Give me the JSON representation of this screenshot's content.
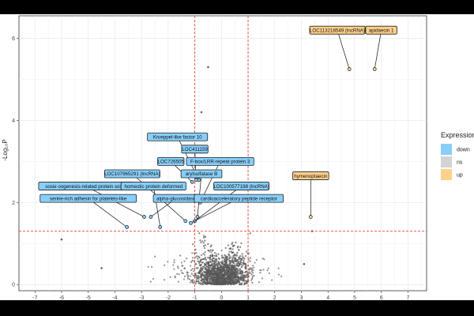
{
  "chart_data": {
    "type": "scatter",
    "title": "",
    "xlabel": "",
    "ylabel": "-Log₁₀P",
    "xlim": [
      -7.6,
      7.7
    ],
    "ylim": [
      -0.15,
      6.55
    ],
    "xticks": [
      -7,
      -6,
      -5,
      -4,
      -3,
      -2,
      -1,
      0,
      1,
      2,
      3,
      4,
      5,
      6,
      7
    ],
    "yticks": [
      0,
      2,
      4,
      6
    ],
    "grid": true,
    "thresholds": {
      "logfc": [
        -1,
        1
      ],
      "neglog10p": 1.3
    },
    "legend": {
      "title": "Expression",
      "placement": "right",
      "entries": [
        {
          "label": "down",
          "color": "#87CEFA"
        },
        {
          "label": "ns",
          "color": "#D3D3D3"
        },
        {
          "label": "up",
          "color": "#FFD08A"
        }
      ]
    },
    "labeled_points": [
      {
        "label": "LOC113218549 (lncRNA)",
        "x": 4.8,
        "y": 5.25,
        "group": "up",
        "lx": 4.35,
        "ly": 6.2
      },
      {
        "label": "apidaecin 1",
        "x": 5.75,
        "y": 5.25,
        "group": "up",
        "lx": 6.0,
        "ly": 6.2
      },
      {
        "label": "hymenoptaecin",
        "x": 3.35,
        "y": 1.65,
        "group": "up",
        "lx": 3.35,
        "ly": 2.65
      },
      {
        "label": "Krueppel-like factor 10",
        "x": -0.85,
        "y": 2.55,
        "group": "down",
        "lx": -1.65,
        "ly": 3.6
      },
      {
        "label": "LOC411159",
        "x": -0.95,
        "y": 2.55,
        "group": "down",
        "lx": -1.0,
        "ly": 3.3
      },
      {
        "label": "LOC726505",
        "x": -1.1,
        "y": 2.5,
        "group": "down",
        "lx": -1.9,
        "ly": 3.0
      },
      {
        "label": "F-box/LRR-repeat protein 3",
        "x": -0.8,
        "y": 2.0,
        "group": "down",
        "lx": -0.05,
        "ly": 3.0
      },
      {
        "label": "LOC107965291 (lncRNA)",
        "x": -1.35,
        "y": 1.55,
        "group": "down",
        "lx": -3.35,
        "ly": 2.7
      },
      {
        "label": "arylsulfatase B",
        "x": -0.9,
        "y": 1.65,
        "group": "down",
        "lx": -0.75,
        "ly": 2.7
      },
      {
        "label": "sosie oogenesis-related protein sosie",
        "x": -2.9,
        "y": 1.65,
        "group": "down",
        "lx": -5.1,
        "ly": 2.4
      },
      {
        "label": "homeotic protein deformed",
        "x": -2.3,
        "y": 1.4,
        "group": "down",
        "lx": -2.55,
        "ly": 2.4
      },
      {
        "label": "LOC100577198 (lncRNA)",
        "x": -1.0,
        "y": 1.55,
        "group": "down",
        "lx": 0.75,
        "ly": 2.4
      },
      {
        "label": "serine-rich adhesin for platelets-like",
        "x": -3.55,
        "y": 1.4,
        "group": "down",
        "lx": -5.0,
        "ly": 2.1
      },
      {
        "label": "alpha-glucosidase",
        "x": -2.65,
        "y": 1.65,
        "group": "down",
        "lx": -1.7,
        "ly": 2.1
      },
      {
        "label": "cardioacceleratory peptide receptor",
        "x": -1.15,
        "y": 1.5,
        "group": "down",
        "lx": 0.65,
        "ly": 2.1
      }
    ],
    "ns_points_outliers": [
      {
        "x": -6.0,
        "y": 1.1
      },
      {
        "x": -4.5,
        "y": 0.4
      },
      {
        "x": 3.1,
        "y": 0.5
      },
      {
        "x": -0.5,
        "y": 5.3
      },
      {
        "x": -0.75,
        "y": 4.2
      },
      {
        "x": 3.4,
        "y": 1.3
      }
    ]
  }
}
